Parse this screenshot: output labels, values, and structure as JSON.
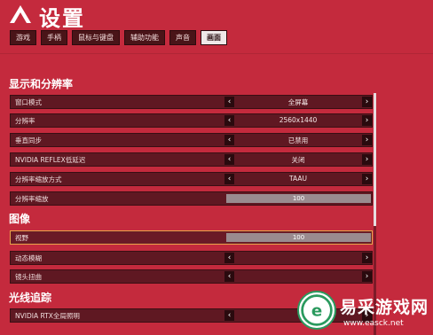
{
  "header": {
    "title": "设置"
  },
  "tabs": [
    {
      "label": "游戏"
    },
    {
      "label": "手柄"
    },
    {
      "label": "鼠标与键盘"
    },
    {
      "label": "辅助功能"
    },
    {
      "label": "声音"
    },
    {
      "label": "画面"
    }
  ],
  "active_tab": "画面",
  "sections": {
    "display": {
      "title": "显示和分辨率",
      "rows": [
        {
          "label": "窗口模式",
          "value": "全屏幕"
        },
        {
          "label": "分辨率",
          "value": "2560x1440"
        },
        {
          "label": "垂直同步",
          "value": "已禁用"
        },
        {
          "label": "NVIDIA REFLEX低延迟",
          "value": "关闭"
        },
        {
          "label": "分辨率缩放方式",
          "value": "TAAU"
        },
        {
          "label": "分辨率缩放",
          "value": "100",
          "level": 1.0
        }
      ]
    },
    "image": {
      "title": "图像",
      "rows": [
        {
          "label": "视野",
          "value": "100",
          "level": 1.0
        },
        {
          "label": "动态模糊",
          "value": ""
        },
        {
          "label": "镜头扭曲",
          "value": ""
        }
      ]
    },
    "raytracing": {
      "title": "光线追踪",
      "rows": [
        {
          "label": "NVIDIA RTX全局照明",
          "value": ""
        }
      ]
    }
  },
  "watermark": {
    "text": "易采游戏网",
    "url": "www.easck.net"
  },
  "colors": {
    "background": "#c42a3d",
    "row": "#5f1822",
    "selected_border": "#e8a64a",
    "watermark_green": "#2a9a5e"
  },
  "icons": {
    "logo": "apex-logo-icon",
    "arrow_left": "chevron-left-icon",
    "arrow_right": "chevron-right-icon",
    "watermark": "easck-logo-icon"
  }
}
